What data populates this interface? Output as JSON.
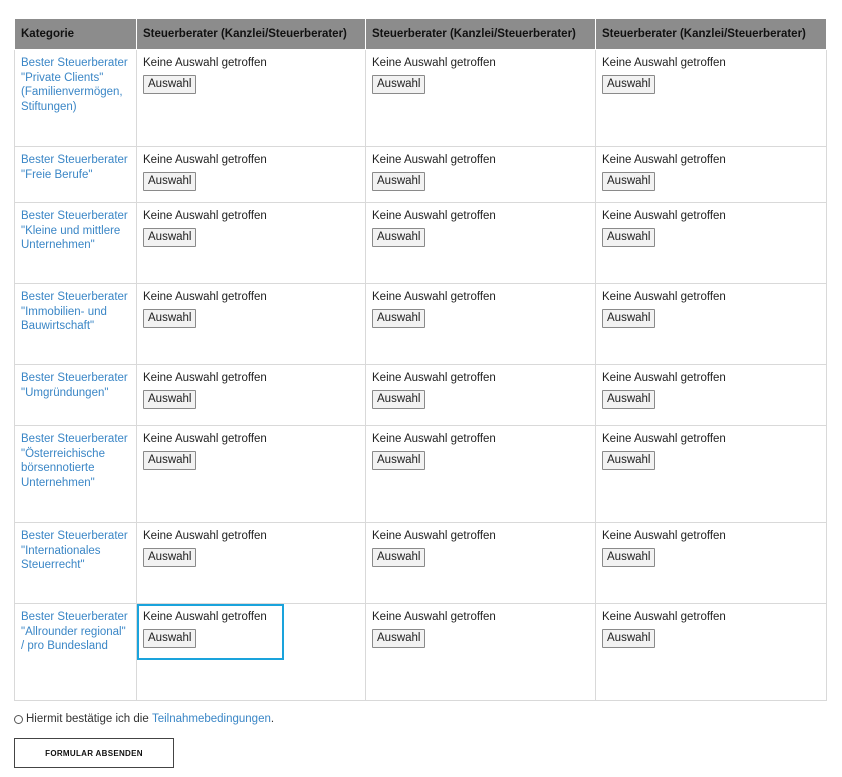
{
  "table": {
    "headers": [
      "Kategorie",
      "Steuerberater (Kanzlei/Steuerberater)",
      "Steuerberater (Kanzlei/Steuerberater)",
      "Steuerberater (Kanzlei/Steuerberater)"
    ],
    "status_text": "Keine Auswahl getroffen",
    "button_label": "Auswahl",
    "rows": [
      {
        "category": "Bester Steuerberater \"Private Clients\" (Familienvermögen, Stiftungen)"
      },
      {
        "category": "Bester Steuerberater \"Freie Berufe\""
      },
      {
        "category": "Bester Steuerberater \"Kleine und mittlere Unternehmen\""
      },
      {
        "category": "Bester Steuerberater \"Immobilien- und Bauwirtschaft\""
      },
      {
        "category": "Bester Steuerberater \"Umgründungen\""
      },
      {
        "category": "Bester Steuerberater \"Österreichische börsennotierte Unternehmen\""
      },
      {
        "category": "Bester Steuerberater \"Internationales Steuerrecht\""
      },
      {
        "category": "Bester Steuerberater \"Allrounder regional\" / pro Bundesland"
      }
    ]
  },
  "footer": {
    "confirm_prefix": "Hiermit bestätige ich die",
    "terms_link": "Teilnahmebedingungen",
    "confirm_suffix": ".",
    "submit_label": "FORMULAR ABSENDEN"
  },
  "colors": {
    "header_bg": "#8c8c8c",
    "link": "#3a86c6",
    "highlight": "#1aa3dc"
  }
}
